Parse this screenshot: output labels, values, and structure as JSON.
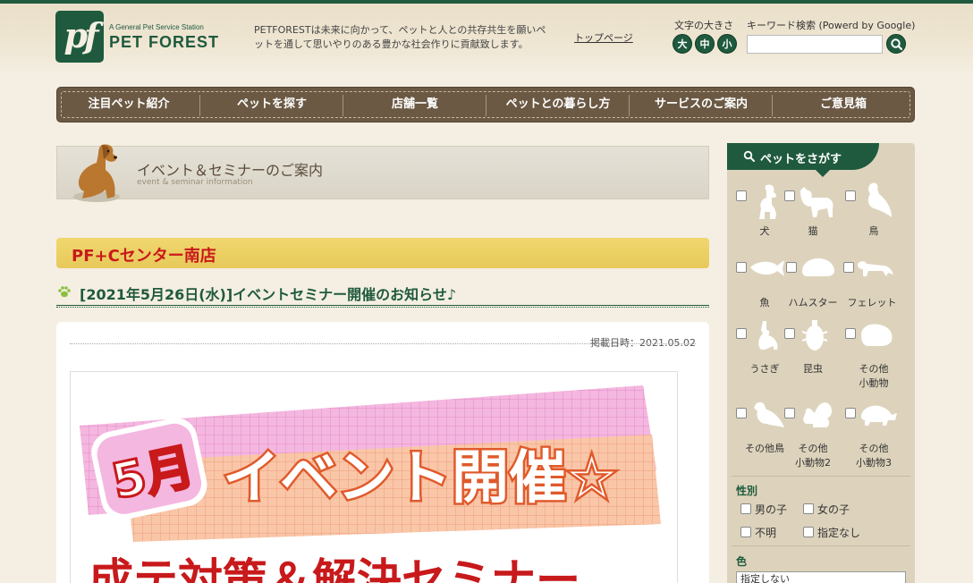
{
  "header": {
    "logo_mark": "pf",
    "logo_subtitle": "A General Pet Service Station",
    "logo_name": "PET FOREST",
    "tagline": "PETFORESTは未来に向かって、ペットと人との共存共生を願いペットを通して思いやりのある豊かな社会作りに貢献致します。",
    "top_link": "トップページ",
    "font_size_label": "文字の大きさ",
    "font_sizes": [
      "大",
      "中",
      "小"
    ],
    "search_label": "キーワード検索 (Powerd by Google)",
    "search_value": ""
  },
  "nav": {
    "items": [
      "注目ペット紹介",
      "ペットを探す",
      "店舗一覧",
      "ペットとの暮らし方",
      "サービスのご案内",
      "ご意見箱"
    ]
  },
  "main": {
    "banner_title": "イベント＆セミナーのご案内",
    "banner_subtitle": "event & seminar information",
    "store_name": "PF+Cセンター南店",
    "post_title": "[2021年5月26日(水)]イベントセミナー開催のお知らせ♪",
    "post_date": "掲載日時：2021.05.02",
    "poster": {
      "month": "5月",
      "headline": "イベント開催☆",
      "bottom_text": "成テ対策＆解決セミナー"
    }
  },
  "sidebar": {
    "title": "ペットをさがす",
    "pets": [
      {
        "label": "犬",
        "icon": "dog-icon"
      },
      {
        "label": "猫",
        "icon": "cat-icon"
      },
      {
        "label": "鳥",
        "icon": "bird-icon"
      },
      {
        "label": "魚",
        "icon": "fish-icon"
      },
      {
        "label": "ハムスター",
        "icon": "hamster-icon"
      },
      {
        "label": "フェレット",
        "icon": "ferret-icon"
      },
      {
        "label": "うさぎ",
        "icon": "rabbit-icon"
      },
      {
        "label": "昆虫",
        "icon": "beetle-icon"
      },
      {
        "label": "その他\n小動物",
        "icon": "small-animal-icon"
      },
      {
        "label": "その他鳥",
        "icon": "other-bird-icon"
      },
      {
        "label": "その他\n小動物2",
        "icon": "squirrel-icon"
      },
      {
        "label": "その他\n小動物3",
        "icon": "turtle-icon"
      }
    ],
    "gender_label": "性別",
    "gender_options": [
      "男の子",
      "女の子",
      "不明",
      "指定なし"
    ],
    "color_label": "色",
    "color_value": "指定しない"
  },
  "colors": {
    "brand_green": "#1f5a3e",
    "nav_brown": "#6b5944",
    "store_yellow": "#e7c95a",
    "store_red": "#c8191b"
  }
}
